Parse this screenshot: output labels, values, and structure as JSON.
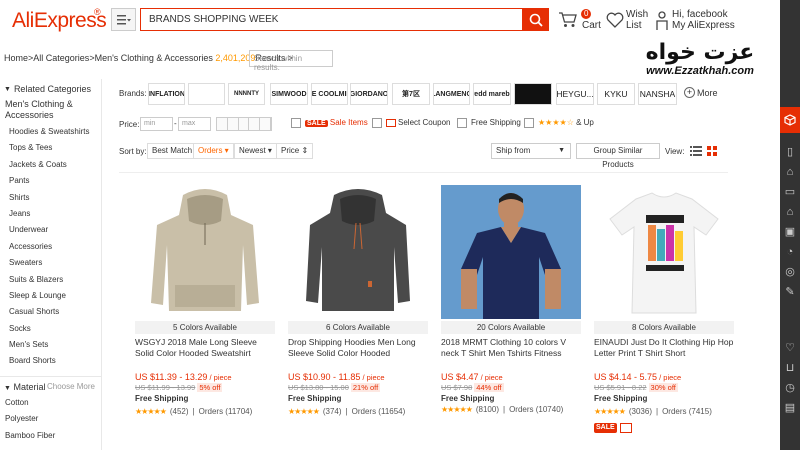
{
  "header": {
    "logo": "AliExpress",
    "logo_mark": "®",
    "category_icon": "hamburger-icon",
    "search_value": "BRANDS SHOPPING WEEK",
    "cart_count": "0",
    "cart_label": "Cart",
    "wish_label_1": "Wish",
    "wish_label_2": "List",
    "greeting": "Hi, facebook",
    "account": "My AliExpress"
  },
  "breadcrumb": {
    "home": "Home",
    "sep": " > ",
    "all": "All Categories",
    "current": "Men's Clothing & Accessories",
    "count": "2,401,209",
    "results": " Results >",
    "within_placeholder": "Search within results."
  },
  "watermark": {
    "fa": "عزت خواه",
    "url": "www.Ezzatkhah.com"
  },
  "sidebar": {
    "related": "Related Categories",
    "title": "Men's Clothing & Accessories",
    "items": [
      "Hoodies & Sweatshirts",
      "Tops & Tees",
      "Jackets & Coats",
      "Pants",
      "Shirts",
      "Jeans",
      "Underwear",
      "Accessories",
      "Sweaters",
      "Suits & Blazers",
      "Sleep & Lounge",
      "Casual Shorts",
      "Socks",
      "Men's Sets",
      "Board Shorts"
    ],
    "material": "Material",
    "choose_more": "Choose More",
    "materials": [
      "Cotton",
      "Polyester",
      "Bamboo Fiber"
    ]
  },
  "filters": {
    "brands_label": "Brands:",
    "brands": [
      "INFLATION",
      "",
      "NNNNTY",
      "SIMWOOD",
      "THE COOLMIND",
      "GIORDANO",
      "第7区",
      "LANGMENG",
      "Aredd mareball",
      "",
      "HEYGU...",
      "KYKU",
      "NANSHA"
    ],
    "more": "More",
    "price_label": "Price:",
    "min_ph": "min",
    "max_ph": "max",
    "dash": "-",
    "sale": "SALE",
    "sale_items": "Sale Items",
    "select_coupon": "Select Coupon",
    "free_shipping": "Free Shipping",
    "and_up": "& Up",
    "rating_stars": "★★★★☆"
  },
  "sort": {
    "label": "Sort by:",
    "best_match": "Best Match",
    "orders": "Orders ▾",
    "newest": "Newest ▾",
    "price": "Price ⇕",
    "ship_from": "Ship from",
    "group": "Group Similar Products",
    "view": "View:"
  },
  "products": [
    {
      "colors": "5 Colors Available",
      "title": "WSGYJ 2018 Male Long Sleeve Solid Color Hooded Sweatshirt",
      "price": "US $11.39 - 13.29",
      "unit": " / piece",
      "orig": "US $11.99 - 13.99",
      "off": "5% off",
      "ship": "Free Shipping",
      "stars": "★★★★★",
      "reviews": "(452)",
      "orders": "Orders (11704)"
    },
    {
      "colors": "6 Colors Available",
      "title": "Drop Shipping Hoodies Men Long Sleeve Solid Color Hooded",
      "price": "US $10.90 - 11.85",
      "unit": " / piece",
      "orig": "US $13.80 - 15.00",
      "off": "21% off",
      "ship": "Free Shipping",
      "stars": "★★★★★",
      "reviews": "(374)",
      "orders": "Orders (11654)"
    },
    {
      "colors": "20 Colors Available",
      "title": "2018 MRMT Clothing 10 colors V neck T Shirt Men Tshirts Fitness",
      "price": "US $4.47",
      "unit": " / piece",
      "orig": "US $7.98",
      "off": "44% off",
      "ship": "Free Shipping",
      "stars": "★★★★★",
      "reviews": "(8100)",
      "orders": "Orders (10740)"
    },
    {
      "colors": "8 Colors Available",
      "title": "EINAUDI Just Do It Clothing Hip Hop Letter Print T Shirt Short",
      "price": "US $4.14 - 5.75",
      "unit": " / piece",
      "orig": "US $5.91 - 8.22",
      "off": "30% off",
      "ship": "Free Shipping",
      "stars": "★★★★★",
      "reviews": "(3036)",
      "orders": "Orders (7415)",
      "sale": "SALE"
    }
  ],
  "colors": {
    "brand_red": "#e62e04",
    "price_red": "#e62e04",
    "star_orange": "#f90",
    "rail_dark": "#333333"
  }
}
